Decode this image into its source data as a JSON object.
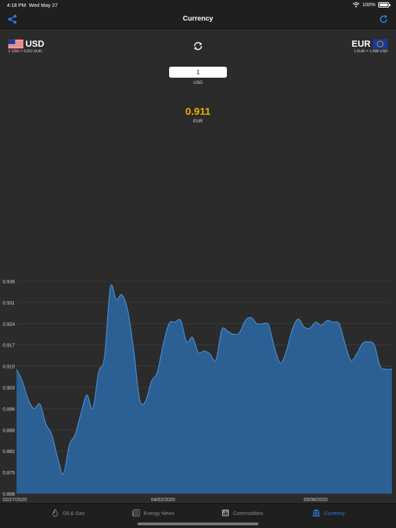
{
  "status_bar": {
    "time": "4:18 PM",
    "date": "Wed May 27",
    "battery": "100%"
  },
  "nav": {
    "title": "Currency",
    "share_icon": "share-icon",
    "refresh_icon": "refresh-icon"
  },
  "converter": {
    "from_code": "USD",
    "from_rate": "1 USD = 0.911 EUR",
    "from_flag": "us-flag-icon",
    "to_code": "EUR",
    "to_rate": "1 EUR = 1.098 USD",
    "to_flag": "eu-flag-icon",
    "swap_icon": "swap-icon",
    "amount": "1",
    "amount_label": "USD",
    "result": "0.911",
    "result_label": "EUR"
  },
  "colors": {
    "accent": "#2f80ed",
    "result": "#f2a900",
    "area_fill": "#2c5f93",
    "area_line": "#4a8fd4"
  },
  "chart_data": {
    "type": "area",
    "series": [
      {
        "x": [
          "02/27/2020",
          "02/28/2020",
          "03/02/2020",
          "03/03/2020",
          "03/04/2020",
          "03/05/2020",
          "03/06/2020",
          "03/09/2020",
          "03/10/2020",
          "03/11/2020",
          "03/12/2020",
          "03/13/2020",
          "03/16/2020",
          "03/17/2020",
          "03/18/2020",
          "03/19/2020",
          "03/20/2020",
          "03/23/2020",
          "03/24/2020",
          "03/25/2020",
          "03/26/2020",
          "03/27/2020",
          "03/30/2020",
          "03/31/2020",
          "04/01/2020",
          "04/02/2020",
          "04/03/2020",
          "04/06/2020",
          "04/07/2020",
          "04/08/2020",
          "04/09/2020",
          "04/10/2020",
          "04/13/2020",
          "04/14/2020",
          "04/15/2020",
          "04/16/2020",
          "04/17/2020",
          "04/20/2020",
          "04/21/2020",
          "04/22/2020",
          "04/23/2020",
          "04/24/2020",
          "04/27/2020",
          "04/28/2020",
          "04/29/2020",
          "04/30/2020",
          "05/01/2020",
          "05/04/2020",
          "05/05/2020",
          "05/06/2020",
          "05/07/2020",
          "05/08/2020",
          "05/11/2020",
          "05/12/2020",
          "05/13/2020",
          "05/14/2020",
          "05/15/2020",
          "05/18/2020",
          "05/19/2020",
          "05/20/2020",
          "05/21/2020",
          "05/22/2020",
          "05/25/2020",
          "05/26/2020",
          "05/27/2020"
        ],
        "values": [
          0.909,
          0.905,
          0.899,
          0.896,
          0.8975,
          0.891,
          0.8875,
          0.88,
          0.8745,
          0.884,
          0.8875,
          0.8945,
          0.9005,
          0.896,
          0.908,
          0.913,
          0.936,
          0.932,
          0.9335,
          0.928,
          0.915,
          0.899,
          0.8985,
          0.905,
          0.908,
          0.917,
          0.924,
          0.9245,
          0.925,
          0.918,
          0.9195,
          0.9145,
          0.915,
          0.914,
          0.912,
          0.922,
          0.9215,
          0.9205,
          0.921,
          0.925,
          0.926,
          0.924,
          0.924,
          0.9235,
          0.916,
          0.911,
          0.915,
          0.922,
          0.9255,
          0.923,
          0.9225,
          0.9245,
          0.9235,
          0.925,
          0.9245,
          0.924,
          0.9175,
          0.912,
          0.914,
          0.9175,
          0.918,
          0.917,
          0.91,
          0.909,
          0.909
        ]
      }
    ],
    "xticks": [
      "02/27/2020",
      "04/02/2020",
      "05/08/2020"
    ],
    "yticks": [
      "0.938",
      "0.931",
      "0.924",
      "0.917",
      "0.910",
      "0.903",
      "0.896",
      "0.889",
      "0.882",
      "0.875",
      "0.868"
    ],
    "ylim": [
      0.868,
      0.938
    ],
    "grid": true
  },
  "tabs": [
    {
      "label": "Oil & Gas",
      "icon": "flame-icon",
      "active": false
    },
    {
      "label": "Energy News",
      "icon": "newspaper-icon",
      "active": false
    },
    {
      "label": "Commodities",
      "icon": "chart-icon",
      "active": false
    },
    {
      "label": "Currency",
      "icon": "bank-icon",
      "active": true
    }
  ]
}
